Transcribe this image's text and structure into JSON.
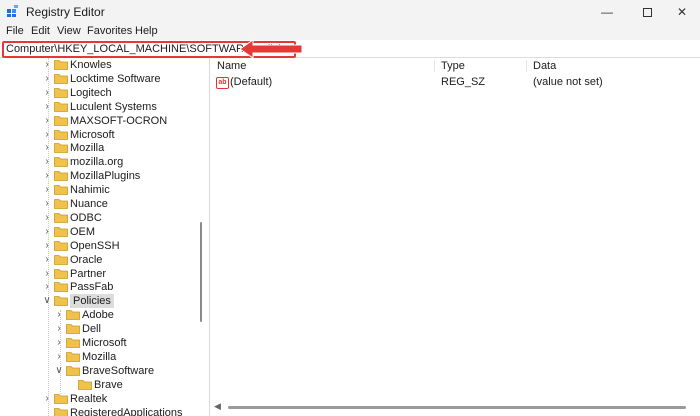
{
  "window": {
    "title": "Registry Editor"
  },
  "menu": [
    "File",
    "Edit",
    "View",
    "Favorites",
    "Help"
  ],
  "address": {
    "value": "Computer\\HKEY_LOCAL_MACHINE\\SOFTWARE\\Policies"
  },
  "tree": [
    {
      "label": "Knowles",
      "depth": 0,
      "expander": "collapsed",
      "selected": false
    },
    {
      "label": "Locktime Software",
      "depth": 0,
      "expander": "collapsed",
      "selected": false
    },
    {
      "label": "Logitech",
      "depth": 0,
      "expander": "collapsed",
      "selected": false
    },
    {
      "label": "Luculent Systems",
      "depth": 0,
      "expander": "collapsed",
      "selected": false
    },
    {
      "label": "MAXSOFT-OCRON",
      "depth": 0,
      "expander": "collapsed",
      "selected": false
    },
    {
      "label": "Microsoft",
      "depth": 0,
      "expander": "collapsed",
      "selected": false
    },
    {
      "label": "Mozilla",
      "depth": 0,
      "expander": "collapsed",
      "selected": false
    },
    {
      "label": "mozilla.org",
      "depth": 0,
      "expander": "collapsed",
      "selected": false
    },
    {
      "label": "MozillaPlugins",
      "depth": 0,
      "expander": "collapsed",
      "selected": false
    },
    {
      "label": "Nahimic",
      "depth": 0,
      "expander": "collapsed",
      "selected": false
    },
    {
      "label": "Nuance",
      "depth": 0,
      "expander": "collapsed",
      "selected": false
    },
    {
      "label": "ODBC",
      "depth": 0,
      "expander": "collapsed",
      "selected": false
    },
    {
      "label": "OEM",
      "depth": 0,
      "expander": "collapsed",
      "selected": false
    },
    {
      "label": "OpenSSH",
      "depth": 0,
      "expander": "collapsed",
      "selected": false
    },
    {
      "label": "Oracle",
      "depth": 0,
      "expander": "collapsed",
      "selected": false
    },
    {
      "label": "Partner",
      "depth": 0,
      "expander": "collapsed",
      "selected": false
    },
    {
      "label": "PassFab",
      "depth": 0,
      "expander": "collapsed",
      "selected": false
    },
    {
      "label": "Policies",
      "depth": 0,
      "expander": "expanded",
      "selected": true
    },
    {
      "label": "Adobe",
      "depth": 1,
      "expander": "collapsed",
      "selected": false
    },
    {
      "label": "Dell",
      "depth": 1,
      "expander": "collapsed",
      "selected": false
    },
    {
      "label": "Microsoft",
      "depth": 1,
      "expander": "collapsed",
      "selected": false
    },
    {
      "label": "Mozilla",
      "depth": 1,
      "expander": "collapsed",
      "selected": false
    },
    {
      "label": "BraveSoftware",
      "depth": 1,
      "expander": "expanded",
      "selected": false
    },
    {
      "label": "Brave",
      "depth": 2,
      "expander": "none",
      "selected": false
    },
    {
      "label": "Realtek",
      "depth": 0,
      "expander": "collapsed",
      "selected": false
    },
    {
      "label": "RegisteredApplications",
      "depth": 0,
      "expander": "none",
      "selected": false
    }
  ],
  "list": {
    "columns": [
      "Name",
      "Type",
      "Data"
    ],
    "rows": [
      {
        "name": "(Default)",
        "type": "REG_SZ",
        "data": "(value not set)",
        "icon": "ab-string-icon"
      }
    ]
  },
  "colors": {
    "folder": "#f0c24b",
    "highlight": "#e53935",
    "selection": "#dcdcdc"
  }
}
